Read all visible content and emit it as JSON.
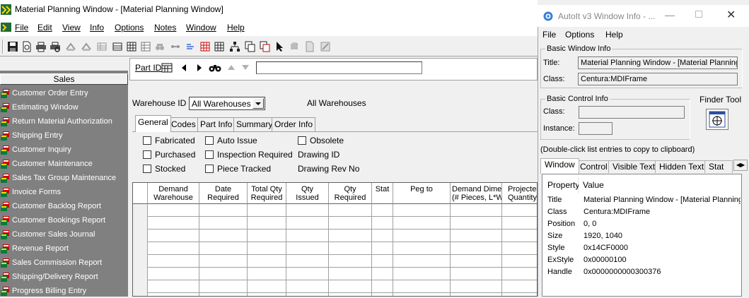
{
  "main_window": {
    "title": "Material Planning Window - [Material Planning Window]",
    "menu": [
      {
        "label": "File"
      },
      {
        "label": "Edit"
      },
      {
        "label": "View"
      },
      {
        "label": "Info"
      },
      {
        "label": "Options"
      },
      {
        "label": "Notes"
      },
      {
        "label": "Window"
      },
      {
        "label": "Help"
      }
    ],
    "toolbar_icons": [
      "save-icon",
      "new-icon",
      "print-icon",
      "print-preview-icon",
      "tool-icon",
      "tool-icon",
      "grid-icon",
      "grid-icon",
      "table-icon",
      "tool-icon",
      "link-icon",
      "grid-icon",
      "list-icon",
      "tree-icon",
      "copy-icon",
      "copy-icon",
      "pointer-icon",
      "refresh-icon",
      "page-icon",
      "edit-icon"
    ]
  },
  "sidebar": {
    "header": "Sales",
    "items": [
      {
        "label": "Customer Order Entry"
      },
      {
        "label": "Estimating Window"
      },
      {
        "label": "Return Material Authorization"
      },
      {
        "label": "Shipping Entry"
      },
      {
        "label": "Customer Inquiry"
      },
      {
        "label": "Customer Maintenance"
      },
      {
        "label": "Sales Tax Group Maintenance"
      },
      {
        "label": "Invoice Forms"
      },
      {
        "label": "Customer Backlog Report"
      },
      {
        "label": "Customer Bookings Report"
      },
      {
        "label": "Customer Sales Journal"
      },
      {
        "label": "Revenue Report"
      },
      {
        "label": "Sales Commission Report"
      },
      {
        "label": "Shipping/Delivery Report"
      },
      {
        "label": "Progress Billing Entry"
      }
    ]
  },
  "part": {
    "label": "Part ID",
    "value": ""
  },
  "warehouse": {
    "label": "Warehouse ID",
    "selected": "All Warehouses",
    "display": "All Warehouses"
  },
  "tabs": [
    {
      "label": "General",
      "active": true
    },
    {
      "label": "Codes"
    },
    {
      "label": "Part Info"
    },
    {
      "label": "Summary"
    },
    {
      "label": "Order Info"
    }
  ],
  "general": {
    "fabricated": "Fabricated",
    "purchased": "Purchased",
    "stocked": "Stocked",
    "auto_issue": "Auto Issue",
    "inspection_required": "Inspection Required",
    "piece_tracked": "Piece Tracked",
    "obsolete": "Obsolete",
    "drawing_id": "Drawing ID",
    "drawing_rev_no": "Drawing Rev No"
  },
  "grid": {
    "columns": [
      {
        "line1": "Demand",
        "line2": "Warehouse"
      },
      {
        "line1": "Date",
        "line2": "Required"
      },
      {
        "line1": "Total Qty",
        "line2": "Required"
      },
      {
        "line1": "Qty",
        "line2": "Issued"
      },
      {
        "line1": "Qty",
        "line2": "Required"
      },
      {
        "line1": "Stat",
        "line2": ""
      },
      {
        "line1": "Peg to",
        "line2": ""
      },
      {
        "line1": "Demand Dime",
        "line2": "(# Pieces, L*W"
      },
      {
        "line1": "Projected",
        "line2": "Quantity"
      }
    ]
  },
  "autoit": {
    "title": "AutoIt v3 Window Info - ...",
    "menu": [
      {
        "label": "File"
      },
      {
        "label": "Options"
      },
      {
        "label": "Help"
      }
    ],
    "basic_window_info": "Basic Window Info",
    "title_label": "Title:",
    "title_value": "Material Planning Window - [Material Planning",
    "class_label": "Class:",
    "class_value": "Centura:MDIFrame",
    "basic_control_info": "Basic Control Info",
    "control_class_label": "Class:",
    "instance_label": "Instance:",
    "finder_tool": "Finder Tool",
    "hint": "(Double-click list entries to copy to clipboard)",
    "tabs": [
      {
        "label": "Window",
        "active": true
      },
      {
        "label": "Control"
      },
      {
        "label": "Visible Text"
      },
      {
        "label": "Hidden Text"
      },
      {
        "label": "Stat"
      }
    ],
    "list_headers": {
      "property": "Property",
      "value": "Value"
    },
    "properties": [
      {
        "key": "Title",
        "value": "Material Planning Window - [Material Planning W"
      },
      {
        "key": "Class",
        "value": "Centura:MDIFrame"
      },
      {
        "key": "Position",
        "value": "0, 0"
      },
      {
        "key": "Size",
        "value": "1920, 1040"
      },
      {
        "key": "Style",
        "value": "0x14CF0000"
      },
      {
        "key": "ExStyle",
        "value": "0x00000100"
      },
      {
        "key": "Handle",
        "value": "0x0000000000300376"
      }
    ]
  }
}
